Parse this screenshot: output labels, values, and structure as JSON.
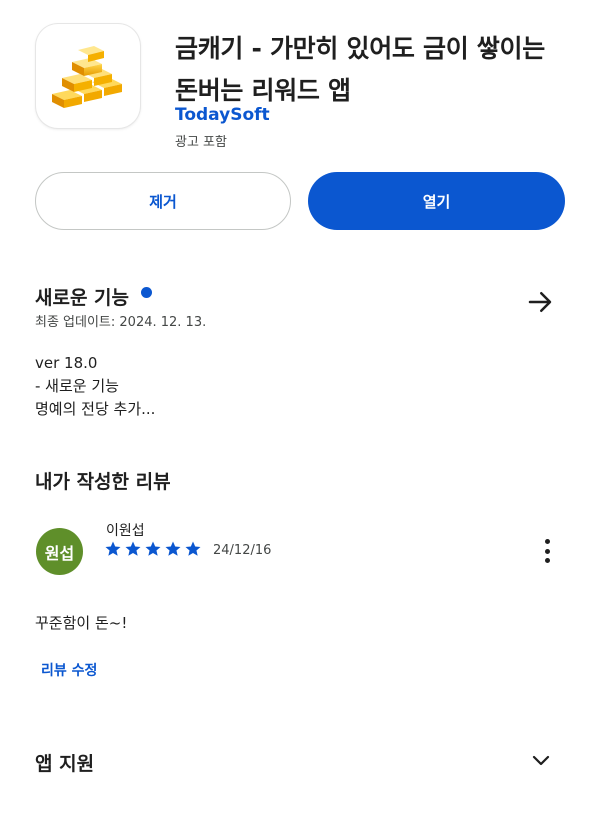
{
  "app": {
    "title_line1": "금캐기 - 가만히 있어도 금이 쌓이는",
    "title_line2": "돈버는 리워드 앱",
    "developer": "TodaySoft",
    "ads_note": "광고 포함",
    "icon": "gold-bars-icon"
  },
  "actions": {
    "remove_label": "제거",
    "open_label": "열기"
  },
  "whats_new": {
    "title": "새로운 기능",
    "last_updated": "최종 업데이트: 2024. 12. 13.",
    "lines": [
      "ver 18.0",
      "- 새로운 기능",
      "명예의 전당 추가..."
    ],
    "arrow_icon": "arrow-right-icon"
  },
  "my_review": {
    "title": "내가 작성한 리뷰",
    "avatar_text": "원섭",
    "reviewer_name": "이원섭",
    "rating": 5,
    "date": "24/12/16",
    "text": "꾸준함이 돈~!",
    "edit_label": "리뷰 수정",
    "menu_icon": "more-vert-icon"
  },
  "app_support": {
    "title": "앱 지원",
    "chevron_icon": "chevron-down-icon"
  },
  "colors": {
    "accent": "#0b57d0",
    "avatar_bg": "#5f8f2a",
    "gold": "#f4b400"
  }
}
